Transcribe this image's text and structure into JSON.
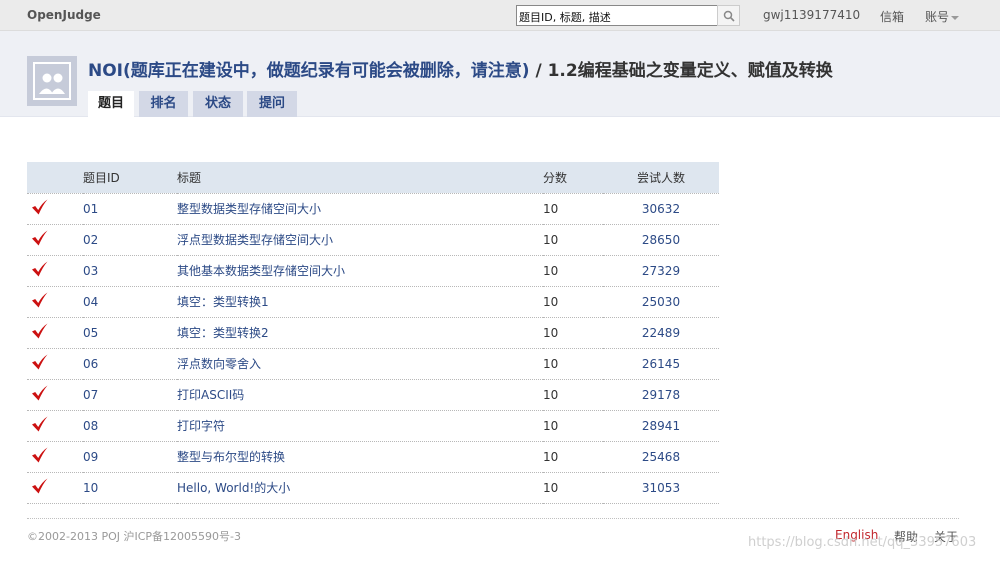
{
  "topbar": {
    "brand": "OpenJudge",
    "search_value": "题目ID, 标题, 描述",
    "user": "gwj1139177410",
    "mail": "信箱",
    "account": "账号"
  },
  "header": {
    "group_name": "NOI(题库正在建设中，做题纪录有可能会被删除，请注意)",
    "separator": " / ",
    "section_name": "1.2编程基础之变量定义、赋值及转换",
    "tabs": [
      {
        "label": "题目"
      },
      {
        "label": "排名"
      },
      {
        "label": "状态"
      },
      {
        "label": "提问"
      }
    ]
  },
  "table": {
    "headers": {
      "id": "题目ID",
      "title": "标题",
      "score": "分数",
      "tries": "尝试人数"
    },
    "rows": [
      {
        "id": "01",
        "title": "整型数据类型存储空间大小",
        "score": "10",
        "tries": "30632"
      },
      {
        "id": "02",
        "title": "浮点型数据类型存储空间大小",
        "score": "10",
        "tries": "28650"
      },
      {
        "id": "03",
        "title": "其他基本数据类型存储空间大小",
        "score": "10",
        "tries": "27329"
      },
      {
        "id": "04",
        "title": "填空：类型转换1",
        "score": "10",
        "tries": "25030"
      },
      {
        "id": "05",
        "title": "填空：类型转换2",
        "score": "10",
        "tries": "22489"
      },
      {
        "id": "06",
        "title": "浮点数向零舍入",
        "score": "10",
        "tries": "26145"
      },
      {
        "id": "07",
        "title": "打印ASCII码",
        "score": "10",
        "tries": "29178"
      },
      {
        "id": "08",
        "title": "打印字符",
        "score": "10",
        "tries": "28941"
      },
      {
        "id": "09",
        "title": "整型与布尔型的转换",
        "score": "10",
        "tries": "25468"
      },
      {
        "id": "10",
        "title": "Hello, World!的大小",
        "score": "10",
        "tries": "31053"
      }
    ]
  },
  "footer": {
    "copyright": "©2002-2013 POJ 沪ICP备12005590号-3",
    "english": "English",
    "help": "帮助",
    "about": "关于",
    "watermark": "https://blog.csdn.net/qq_33957603"
  },
  "colors": {
    "link": "#2c4a86",
    "check": "#cc1111",
    "english": "#c2272d"
  },
  "icons": {
    "solved": "check-mark-icon",
    "search": "search-icon",
    "group": "group-avatar-icon"
  }
}
